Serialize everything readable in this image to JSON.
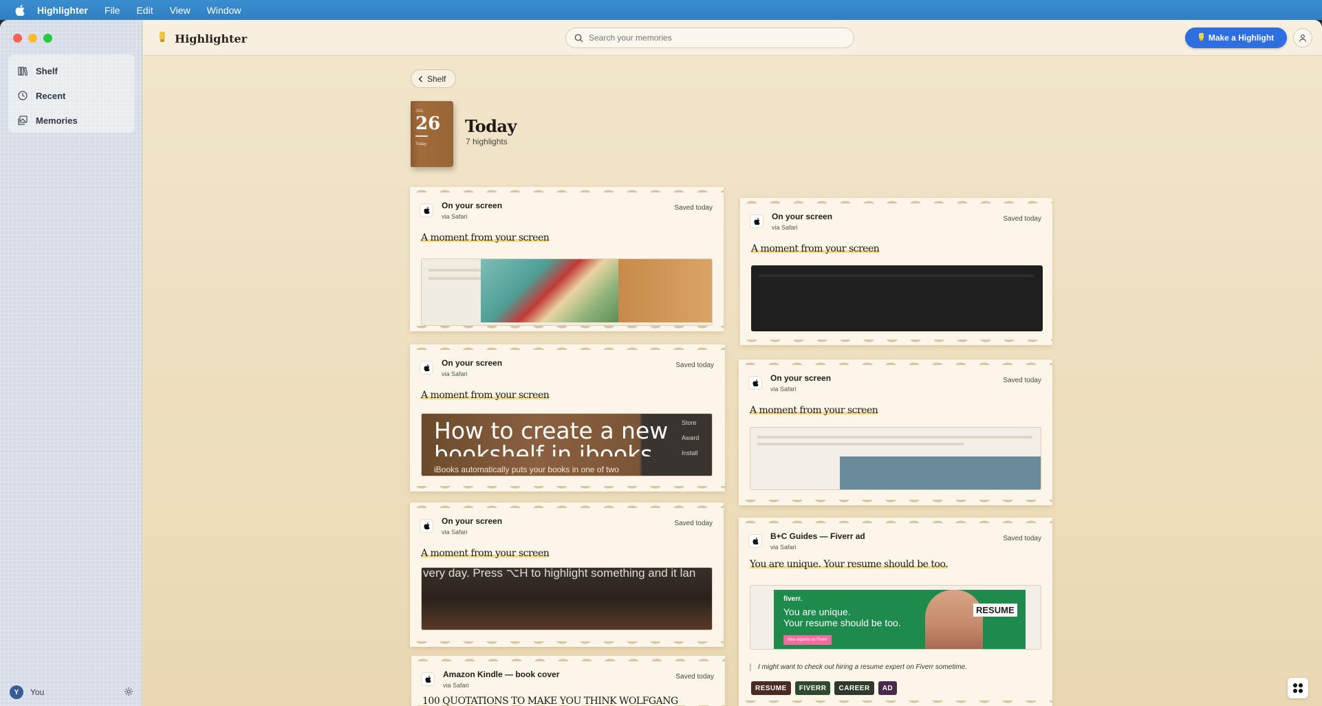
{
  "menubar": {
    "app": "Highlighter",
    "items": [
      "File",
      "Edit",
      "View",
      "Window"
    ]
  },
  "sidebar": {
    "items": [
      {
        "label": "Shelf",
        "icon": "books-icon"
      },
      {
        "label": "Recent",
        "icon": "clock-icon"
      },
      {
        "label": "Memories",
        "icon": "photos-icon"
      }
    ],
    "user": {
      "initial": "Y",
      "name": "You"
    }
  },
  "topbar": {
    "brand": "Highlighter",
    "search_placeholder": "Search your memories",
    "cta_label": "Make a Highlight"
  },
  "page": {
    "back_label": "Shelf",
    "calendar": {
      "month": "JUL",
      "day": "26",
      "label": "Today"
    },
    "title": "Today",
    "count": "7 highlights"
  },
  "cards": [
    {
      "source": "On your screen",
      "via": "via Safari",
      "saved": "Saved today",
      "title": "A moment from your screen"
    },
    {
      "source": "On your screen",
      "via": "via Safari",
      "saved": "Saved today",
      "title": "A moment from your screen",
      "shot_text": {
        "big": "How to create a new bookshelf in ibooks o...",
        "small": "iBooks automatically puts your books in one of two",
        "side": [
          "Store",
          "Award",
          "Install"
        ]
      }
    },
    {
      "source": "On your screen",
      "via": "via Safari",
      "saved": "Saved today",
      "title": "A moment from your screen",
      "shot_text": {
        "big": "very day. Press ⌥H to highlight something and it lan"
      }
    },
    {
      "source": "Amazon Kindle — book cover",
      "via": "via Safari",
      "saved": "Saved today",
      "title": "100 QUOTATIONS TO MAKE YOU THINK WOLFGANG"
    },
    {
      "source": "On your screen",
      "via": "via Safari",
      "saved": "Saved today",
      "title": "A moment from your screen"
    },
    {
      "source": "On your screen",
      "via": "via Safari",
      "saved": "Saved today",
      "title": "A moment from your screen"
    },
    {
      "source": "B+C Guides — Fiverr ad",
      "via": "via Safari",
      "saved": "Saved today",
      "title": "You are unique. Your resume should be too.",
      "ad": {
        "brand": "fiverr.",
        "line1": "You are unique.",
        "line2": "Your resume should be too.",
        "button": "Hire experts on Fiverr",
        "side": "RESUME"
      },
      "note": "I might want to check out hiring a resume expert on Fiverr sometime.",
      "tags": [
        {
          "label": "RESUME",
          "color": "#4a2a22"
        },
        {
          "label": "FIVERR",
          "color": "#2f4a2e"
        },
        {
          "label": "CAREER",
          "color": "#2e3a2c"
        },
        {
          "label": "AD",
          "color": "#4a2a4a"
        }
      ]
    }
  ],
  "colors": {
    "accent": "#2d6fe0",
    "highlight": "#f3d98a",
    "card": "#fbf6e9"
  }
}
